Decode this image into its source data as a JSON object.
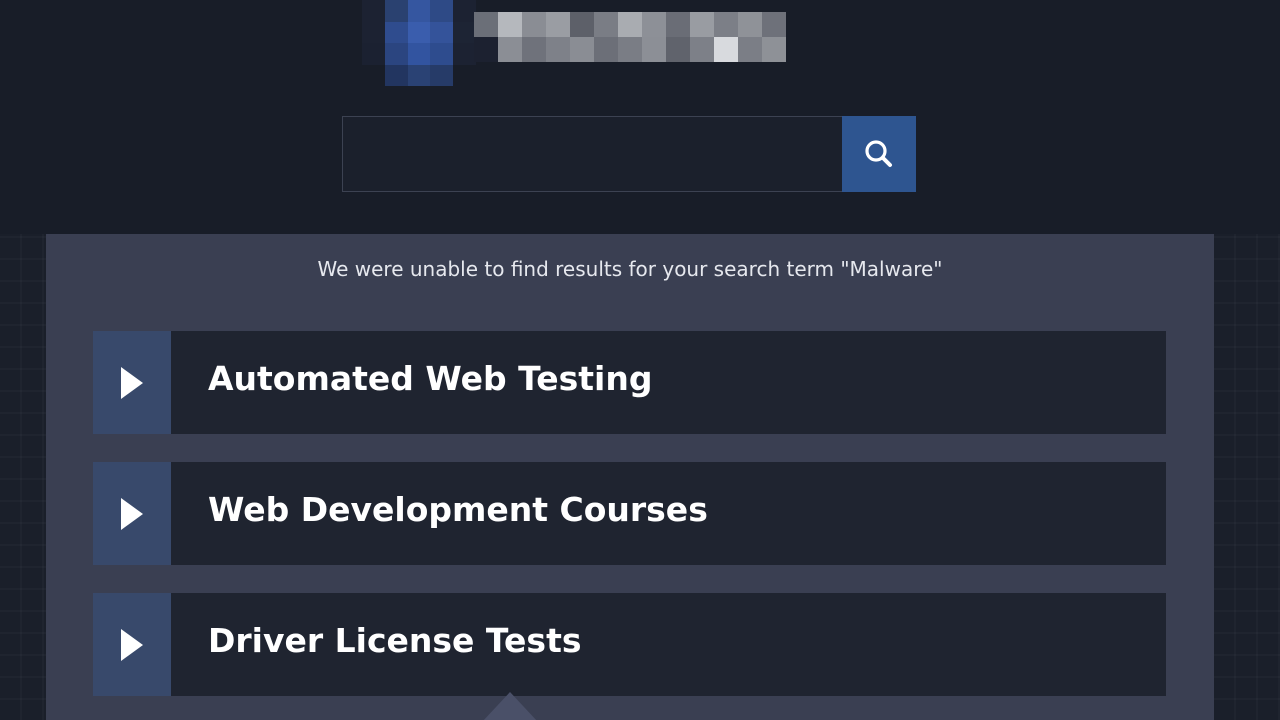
{
  "search": {
    "value": "",
    "placeholder": ""
  },
  "message": "We were unable to find results for your search term \"Malware\"",
  "results": [
    {
      "label": "Automated Web Testing"
    },
    {
      "label": "Web Development Courses"
    },
    {
      "label": "Driver License Tests"
    }
  ],
  "colors": {
    "background": "#181d28",
    "panel": "#3a3f52",
    "card": "#1f2430",
    "toggle": "#38496b",
    "search_button": "#2e5590"
  },
  "icons": {
    "search_button": "search-icon",
    "result_toggle": "play-triangle-icon"
  }
}
